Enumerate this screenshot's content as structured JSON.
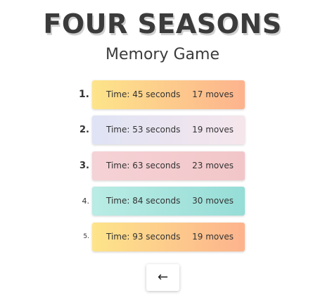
{
  "header": {
    "title": "FOUR SEASONS",
    "subtitle": "Memory Game"
  },
  "leaderboard": [
    {
      "rank": "1.",
      "time": "Time: 45 seconds",
      "moves": "17 moves",
      "theme": "summer"
    },
    {
      "rank": "2.",
      "time": "Time: 53 seconds",
      "moves": "19 moves",
      "theme": "winter"
    },
    {
      "rank": "3.",
      "time": "Time: 63 seconds",
      "moves": "23 moves",
      "theme": "autumn"
    },
    {
      "rank": "4.",
      "time": "Time: 84 seconds",
      "moves": "30 moves",
      "theme": "spring"
    },
    {
      "rank": "5.",
      "time": "Time: 93 seconds",
      "moves": "19 moves",
      "theme": "summer"
    }
  ],
  "back_button": {
    "icon": "arrow-left-icon",
    "label": "←"
  },
  "colors": {
    "summer": [
      "#fde48a",
      "#fdb38d"
    ],
    "winter": [
      "#dfe3f5",
      "#f6e6ec"
    ],
    "autumn": [
      "#f5d2d6",
      "#f2c6c8"
    ],
    "spring": [
      "#b9ece4",
      "#96ddd7"
    ],
    "text": "#333333"
  }
}
